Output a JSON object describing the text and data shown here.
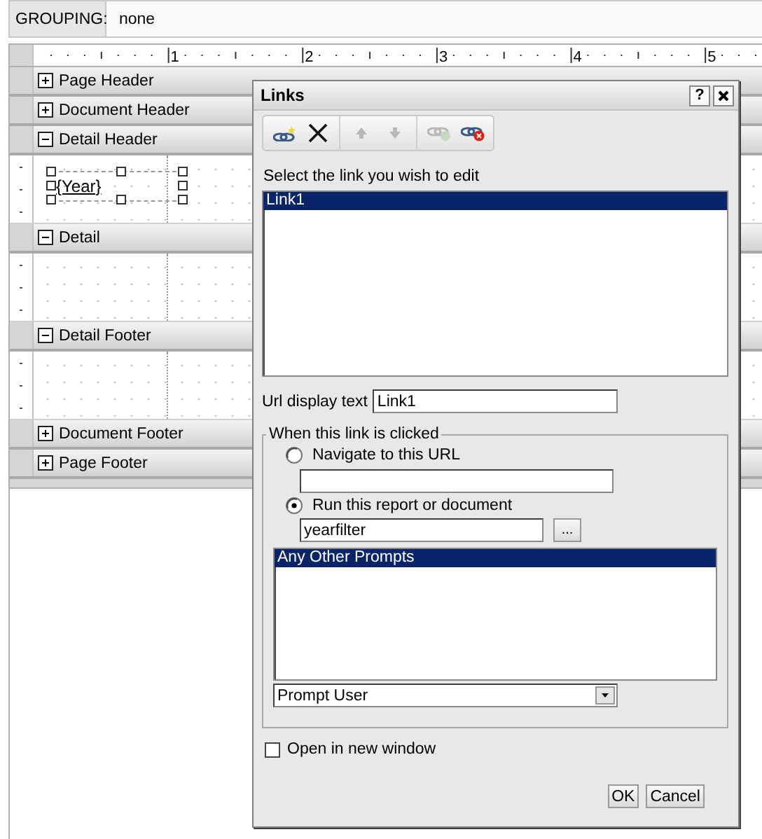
{
  "grouping": {
    "label": "GROUPING:",
    "value": "none"
  },
  "ruler": {
    "labels": [
      "1",
      "2",
      "3",
      "4",
      "5"
    ]
  },
  "sections": [
    {
      "title": "Page Header",
      "expanded": false
    },
    {
      "title": "Document Header",
      "expanded": false
    },
    {
      "title": "Detail Header",
      "expanded": true,
      "fields": [
        {
          "text": "{Year}",
          "selected": true
        }
      ]
    },
    {
      "title": "Detail",
      "expanded": true
    },
    {
      "title": "Detail Footer",
      "expanded": true
    },
    {
      "title": "Document Footer",
      "expanded": false
    },
    {
      "title": "Page Footer",
      "expanded": false
    }
  ],
  "dialog": {
    "title": "Links",
    "help": "?",
    "toolbar_groups": [
      {
        "buttons": [
          {
            "kind": "add-link",
            "disabled": false
          },
          {
            "kind": "delete",
            "disabled": false
          }
        ]
      },
      {
        "buttons": [
          {
            "kind": "move-up",
            "disabled": true
          },
          {
            "kind": "move-down",
            "disabled": true
          }
        ]
      },
      {
        "buttons": [
          {
            "kind": "test-link",
            "disabled": true
          },
          {
            "kind": "remove-link",
            "disabled": false
          }
        ]
      }
    ],
    "list_label": "Select the link you wish to edit",
    "links": [
      {
        "label": "Link1",
        "selected": true
      }
    ],
    "url_display": {
      "label": "Url display text",
      "value": "Link1"
    },
    "action": {
      "legend": "When this link is clicked",
      "options": [
        {
          "kind": "url",
          "label": "Navigate to this URL",
          "selected": false
        },
        {
          "kind": "report",
          "label": "Run this report or document",
          "selected": true,
          "value": "yearfilter",
          "browse": "...",
          "prompts": [
            {
              "label": "Any Other Prompts",
              "selected": true
            }
          ],
          "prompt_mode": "Prompt User"
        }
      ]
    },
    "new_window": {
      "label": "Open in new window",
      "checked": false
    },
    "buttons": [
      "OK",
      "Cancel"
    ]
  }
}
